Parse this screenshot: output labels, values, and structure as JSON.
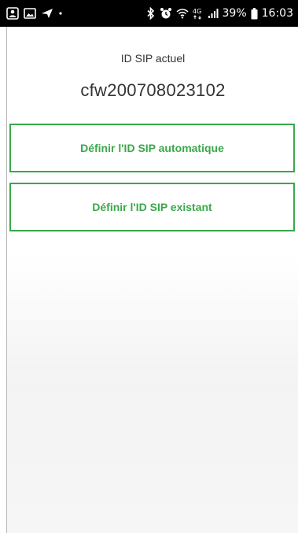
{
  "status_bar": {
    "left_icons": [
      "sim-card-icon",
      "image-icon",
      "send-icon",
      "dot-icon"
    ],
    "right_icons": [
      "bluetooth-icon",
      "alarm-icon",
      "wifi-icon",
      "4g-icon",
      "signal-icon"
    ],
    "battery_percent": "39%",
    "time": "16:03",
    "network_label": "4G"
  },
  "sip": {
    "current_label": "ID SIP actuel",
    "current_value": "cfw200708023102"
  },
  "actions": {
    "auto_label": "Définir l'ID SIP automatique",
    "existing_label": "Définir l'ID SIP existant"
  },
  "colors": {
    "accent": "#3aa84a",
    "status_bar": "#000000",
    "text": "#333333"
  }
}
